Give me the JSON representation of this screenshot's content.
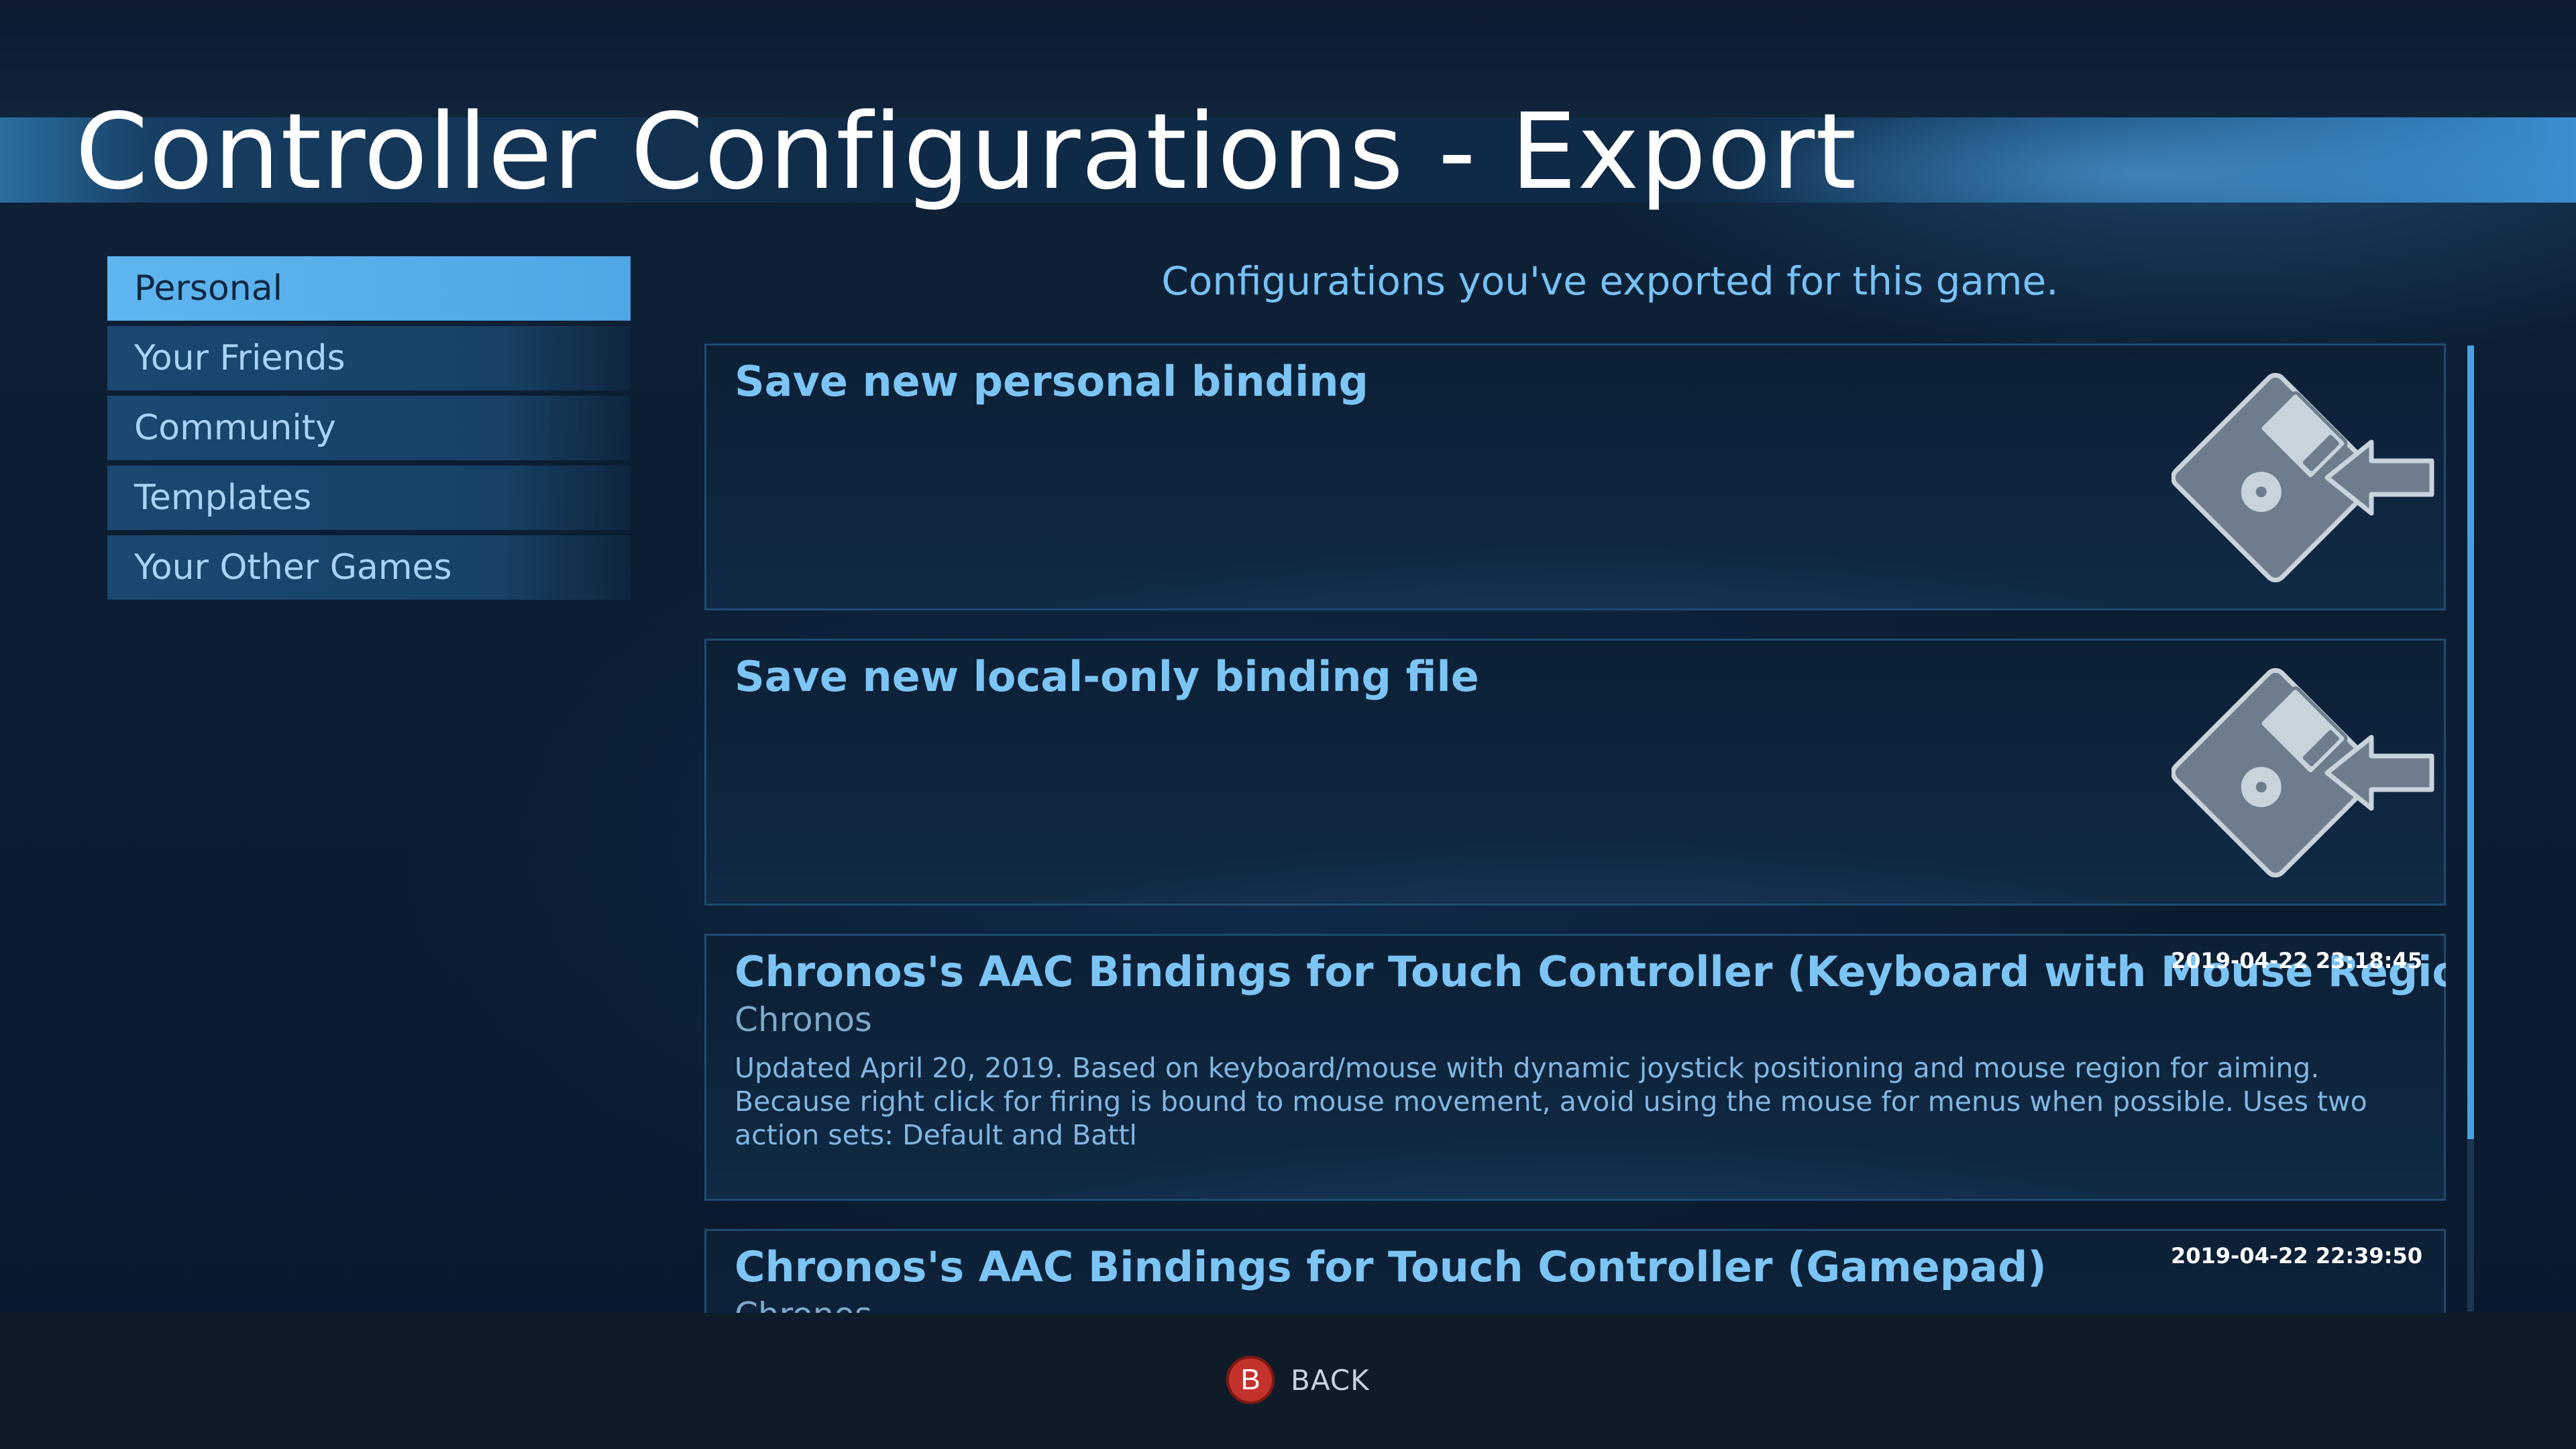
{
  "page": {
    "title": "Controller Configurations - Export",
    "subtitle": "Configurations you've exported for this game."
  },
  "sidebar": {
    "items": [
      {
        "label": "Personal",
        "active": true
      },
      {
        "label": "Your Friends",
        "active": false
      },
      {
        "label": "Community",
        "active": false
      },
      {
        "label": "Templates",
        "active": false
      },
      {
        "label": "Your Other Games",
        "active": false
      }
    ]
  },
  "cards": [
    {
      "title": "Save new personal binding",
      "icon": "floppy-disk-save-icon"
    },
    {
      "title": "Save new local-only binding file",
      "icon": "floppy-disk-save-icon"
    },
    {
      "title": "Chronos's AAC Bindings for Touch Controller (Keyboard with Mouse Region)",
      "author": "Chronos",
      "date": "2019-04-22 23:18:45",
      "description": "Updated April 20, 2019. Based on keyboard/mouse with dynamic joystick positioning and mouse region for aiming. Because right click for firing is bound to mouse movement, avoid using the mouse for menus when possible. Uses two action sets: Default and Battl"
    },
    {
      "title": "Chronos's AAC Bindings for Touch Controller (Gamepad)",
      "author": "Chronos",
      "date": "2019-04-22 22:39:50"
    }
  ],
  "footer": {
    "back_glyph": "B",
    "back_label": "BACK"
  },
  "colors": {
    "accent": "#5fb5ee",
    "title_blue": "#7cc4f4",
    "back_button_red": "#c4332b"
  }
}
